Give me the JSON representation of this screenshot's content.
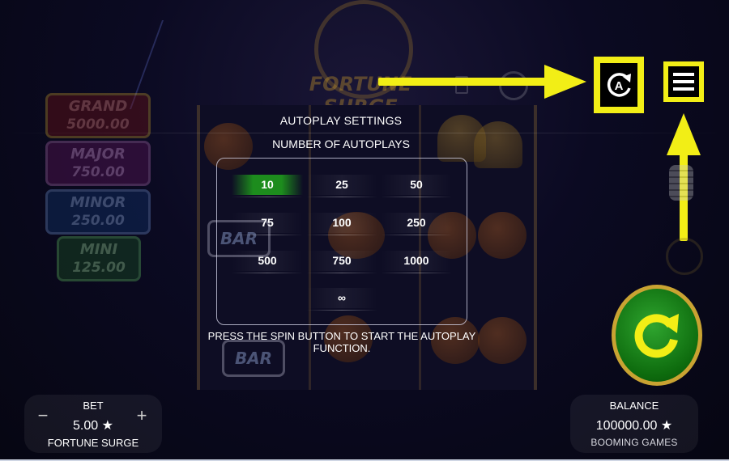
{
  "jackpots": [
    {
      "name": "GRAND",
      "value": "5000.00"
    },
    {
      "name": "MAJOR",
      "value": "750.00"
    },
    {
      "name": "MINOR",
      "value": "250.00"
    },
    {
      "name": "MINI",
      "value": "125.00"
    }
  ],
  "game_logo": "FORTUNE SURGE",
  "reel_bar_label": "BAR",
  "autoplay": {
    "title": "AUTOPLAY SETTINGS",
    "subtitle": "NUMBER OF AUTOPLAYS",
    "options": [
      "10",
      "25",
      "50",
      "75",
      "100",
      "250",
      "500",
      "750",
      "1000",
      "∞"
    ],
    "selected": "10",
    "hint": "PRESS THE SPIN BUTTON TO START THE AUTOPLAY FUNCTION."
  },
  "controls": {
    "autoplay_icon": "autoplay-icon",
    "menu_icon": "hamburger-menu-icon",
    "spin_icon": "spin-arrow-icon",
    "highlight_color": "#f2ee16"
  },
  "bet": {
    "label": "BET",
    "value": "5.00 ★",
    "minus": "−",
    "plus": "+",
    "game_name": "FORTUNE SURGE"
  },
  "balance": {
    "label": "BALANCE",
    "value": "100000.00 ★",
    "provider": "BOOMING GAMES"
  }
}
